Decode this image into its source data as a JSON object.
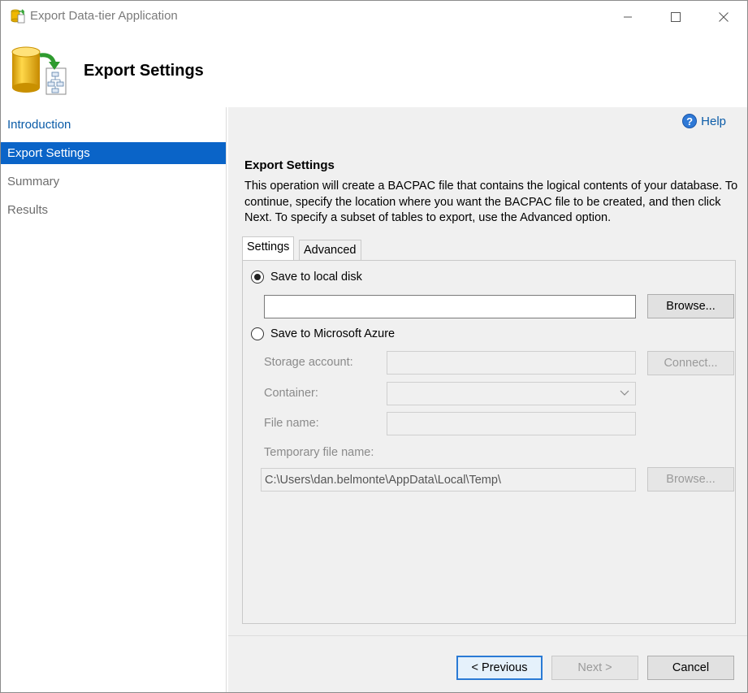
{
  "window": {
    "title": "Export Data-tier Application",
    "controls": {
      "minimize": "minimize-icon",
      "maximize": "maximize-icon",
      "close": "close-icon"
    }
  },
  "header": {
    "title": "Export Settings"
  },
  "nav": {
    "items": [
      {
        "label": "Introduction",
        "state": "link"
      },
      {
        "label": "Export Settings",
        "state": "active"
      },
      {
        "label": "Summary",
        "state": "disabled"
      },
      {
        "label": "Results",
        "state": "disabled"
      }
    ]
  },
  "help": {
    "label": "Help"
  },
  "section": {
    "title": "Export Settings",
    "description": "This operation will create a BACPAC file that contains the logical contents of your database. To continue, specify the location where you want the BACPAC file to be created, and then click Next. To specify a subset of tables to export, use the Advanced option."
  },
  "tabs": [
    {
      "label": "Settings",
      "selected": true
    },
    {
      "label": "Advanced",
      "selected": false
    }
  ],
  "settings": {
    "local": {
      "radio_label": "Save to local disk",
      "selected": true,
      "path_value": "",
      "browse_label": "Browse..."
    },
    "azure": {
      "radio_label": "Save to Microsoft Azure",
      "selected": false,
      "storage_account_label": "Storage account:",
      "storage_account_value": "",
      "connect_label": "Connect...",
      "container_label": "Container:",
      "container_value": "",
      "file_name_label": "File name:",
      "file_name_value": "",
      "temp_file_label": "Temporary file name:",
      "temp_file_value": "C:\\Users\\dan.belmonte\\AppData\\Local\\Temp\\",
      "temp_browse_label": "Browse..."
    }
  },
  "footer": {
    "previous_label": "< Previous",
    "next_label": "Next >",
    "cancel_label": "Cancel"
  },
  "colors": {
    "accent": "#0a64c8",
    "link": "#0b5ca8",
    "panel_bg": "#f0f0f0"
  }
}
